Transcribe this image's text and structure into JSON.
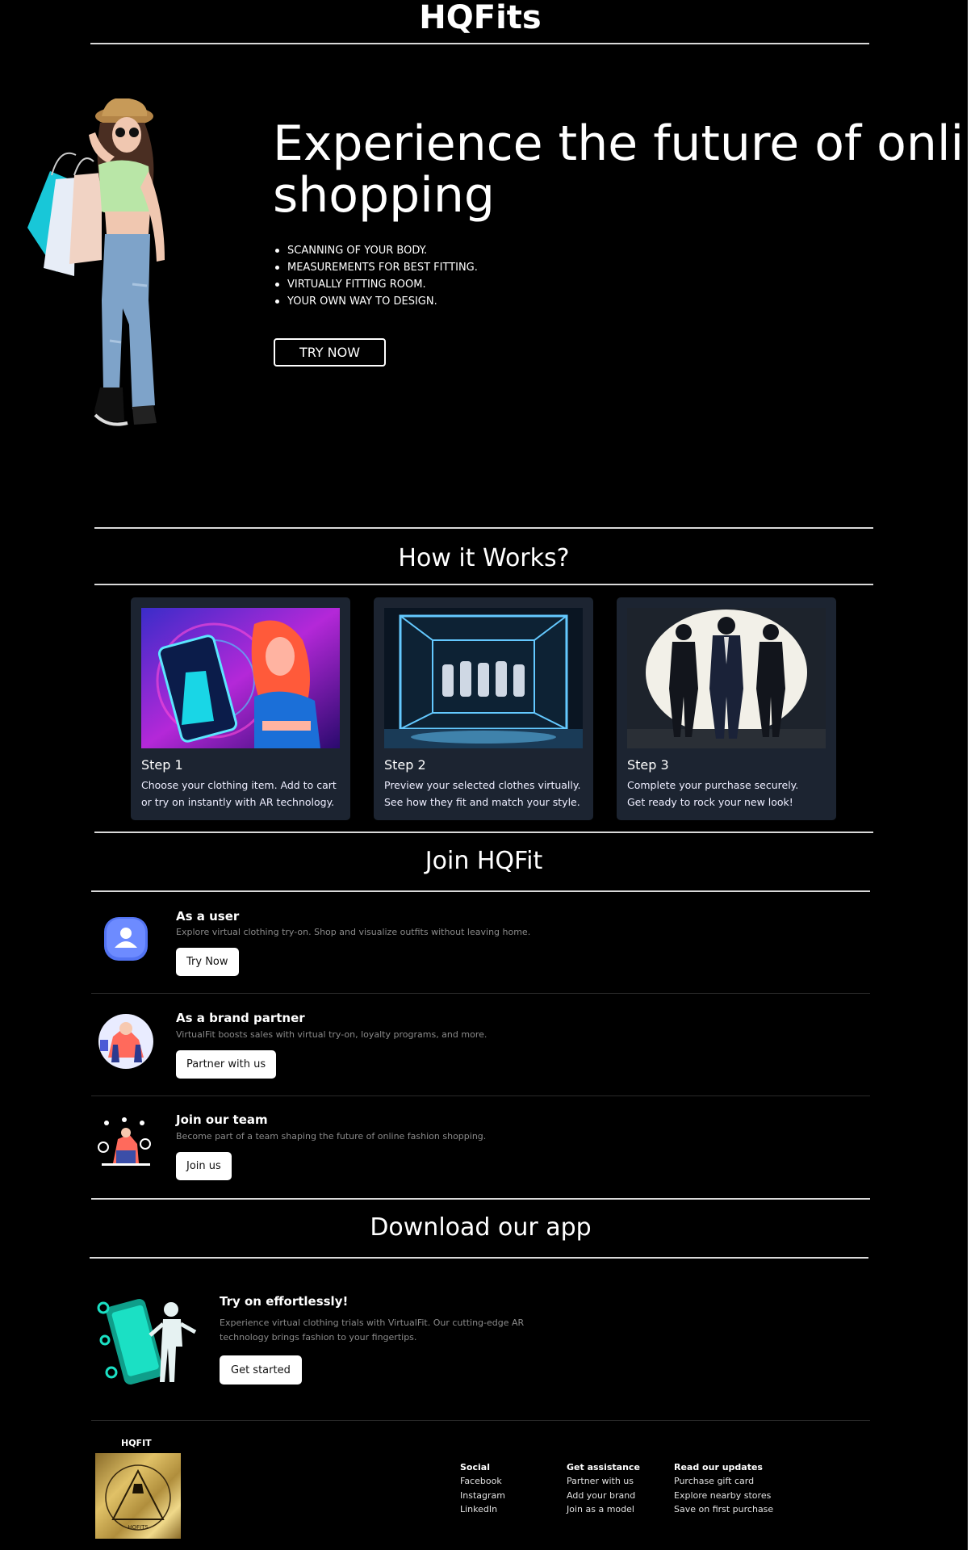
{
  "header": {
    "brand": "HQFits"
  },
  "hero": {
    "title_line1": "Experience the future of online",
    "title_line2": "shopping",
    "features": [
      "SCANNING OF YOUR BODY.",
      "MEASUREMENTS FOR BEST FITTING.",
      "VIRTUALLY FITTING ROOM.",
      "YOUR OWN WAY TO DESIGN."
    ],
    "cta_label": "TRY NOW"
  },
  "how": {
    "title": "How it Works?",
    "steps": [
      {
        "name": "Step 1",
        "desc_line1": "Choose your clothing item. Add to cart",
        "desc_line2": "or try on instantly with AR technology."
      },
      {
        "name": "Step 2",
        "desc_line1": "Preview your selected clothes virtually.",
        "desc_line2": "See how they fit and match your style."
      },
      {
        "name": "Step 3",
        "desc_line1": "Complete your purchase securely.",
        "desc_line2": "Get ready to rock your new look!"
      }
    ]
  },
  "join": {
    "title": "Join HQFit",
    "items": [
      {
        "title": "As a user",
        "desc": "Explore virtual clothing try-on. Shop and visualize outfits without leaving home.",
        "button": "Try Now"
      },
      {
        "title": "As a brand partner",
        "desc": "VirtualFit boosts sales with virtual try-on, loyalty programs, and more.",
        "button": "Partner with us"
      },
      {
        "title": "Join our team",
        "desc": "Become part of a team shaping the future of online fashion shopping.",
        "button": "Join us"
      }
    ]
  },
  "download": {
    "title": "Download our app",
    "heading": "Try on effortlessly!",
    "desc_line1": "Experience virtual clothing trials with VirtualFit. Our cutting-edge AR",
    "desc_line2": "technology brings fashion to your fingertips.",
    "button": "Get started"
  },
  "footer": {
    "brand": "HQFIT",
    "logo_text": "HQFITS",
    "columns": [
      {
        "title": "Social",
        "links": [
          "Facebook",
          "Instagram",
          "LinkedIn"
        ]
      },
      {
        "title": "Get assistance",
        "links": [
          "Partner with us",
          "Add your brand",
          "Join as a model"
        ]
      },
      {
        "title": "Read our updates",
        "links": [
          "Purchase gift card",
          "Explore nearby stores",
          "Save on first purchase"
        ]
      }
    ]
  },
  "colors": {
    "background": "#000000",
    "card": "#1c2431",
    "text": "#ffffff",
    "muted": "#8a8a8a",
    "accent_blue": "#4f6df5"
  }
}
